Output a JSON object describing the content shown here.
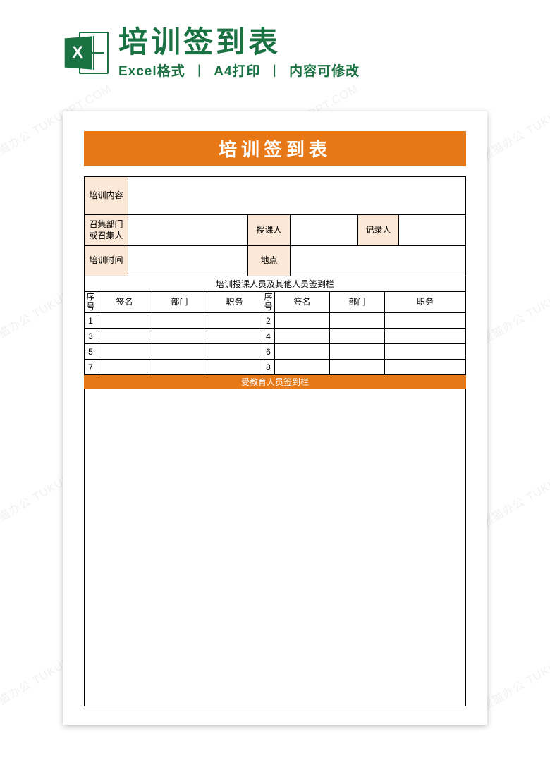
{
  "header": {
    "icon_letter": "X",
    "title": "培训签到表",
    "sub_format": "Excel格式",
    "sub_print": "A4打印",
    "sub_editable": "内容可修改"
  },
  "doc": {
    "title": "培训签到表",
    "labels": {
      "content": "培训内容",
      "organizer": "召集部门\n或召集人",
      "lecturer": "授课人",
      "recorder": "记录人",
      "time": "培训时间",
      "location": "地点"
    },
    "signin_section_title": "培训授课人员及其他人员签到栏",
    "columns": {
      "seq": "序号",
      "sign": "签名",
      "dept": "部门",
      "role": "职务"
    },
    "rows_left": [
      "1",
      "3",
      "5",
      "7"
    ],
    "rows_right": [
      "2",
      "4",
      "6",
      "8"
    ],
    "trainee_section_title": "受教育人员签到栏"
  },
  "watermark": "熊猫办公 TUKUPPT.COM"
}
